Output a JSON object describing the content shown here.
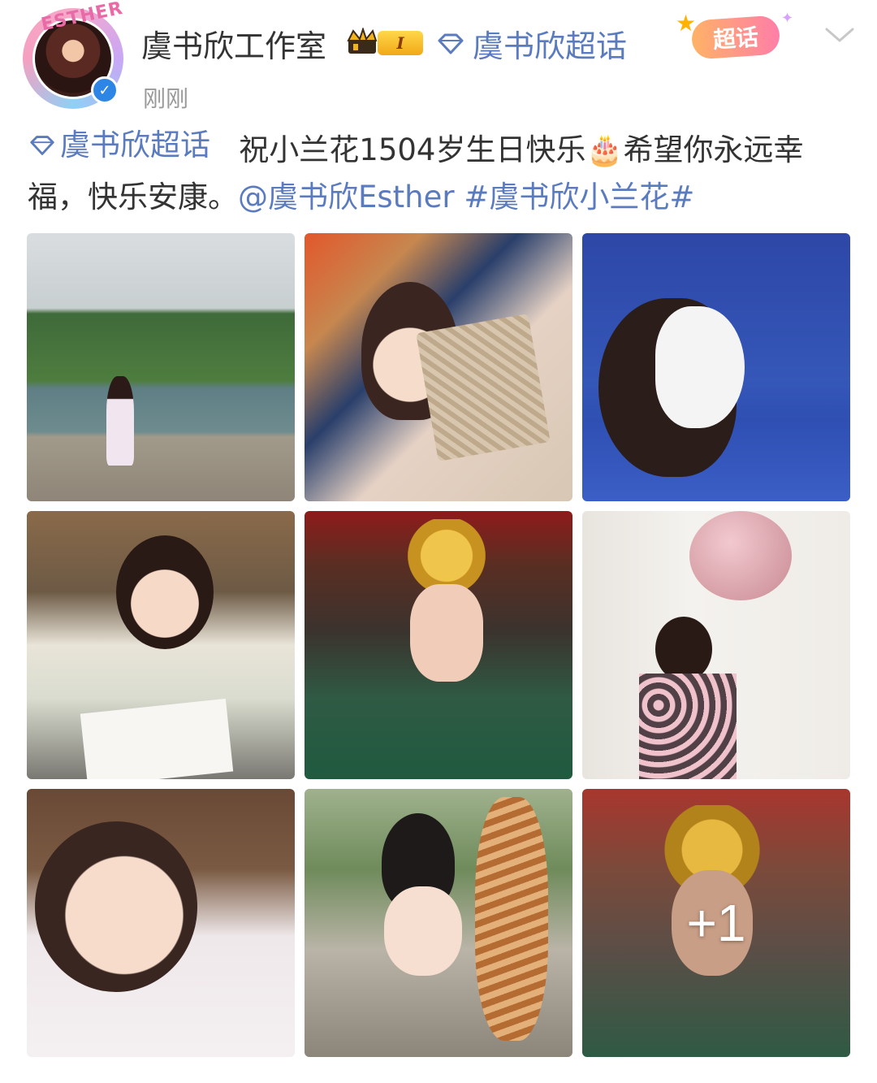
{
  "header": {
    "avatar_deco_text": "ESTHER",
    "username": "虞书欣工作室",
    "level": "I",
    "topic_name": "虞书欣超话",
    "timestamp": "刚刚",
    "supertopic_button": "超话"
  },
  "post": {
    "topic_tag": "虞书欣超话",
    "text_main": "祝小兰花1504岁生日快乐",
    "text_cake": "🎂",
    "text_rest": "希望你永远幸福，快乐安康。",
    "mention": "@虞书欣Esther",
    "hashtag": "#虞书欣小兰花#"
  },
  "gallery": {
    "more_count": "+1"
  },
  "colors": {
    "link": "#5b7bbf",
    "verified": "#2d86e6",
    "muted": "#999999"
  }
}
